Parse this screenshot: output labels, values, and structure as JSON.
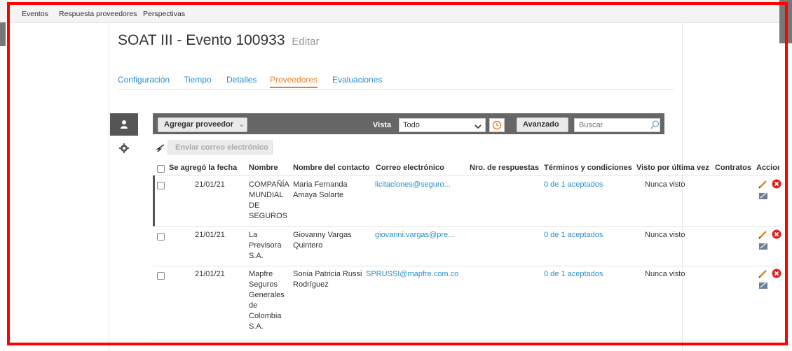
{
  "topnav": {
    "items": [
      "Eventos",
      "Respuesta proveedores",
      "Perspectivas"
    ]
  },
  "page": {
    "title": "SOAT III - Evento 100933",
    "edit_label": "Editar"
  },
  "tabs": [
    {
      "label": "Configuración",
      "active": false
    },
    {
      "label": "Tiempo",
      "active": false
    },
    {
      "label": "Detalles",
      "active": false
    },
    {
      "label": "Proveedores",
      "active": true
    },
    {
      "label": "Evaluaciones",
      "active": false
    }
  ],
  "toolbar": {
    "add_supplier_label": "Agregar proveedor",
    "view_label": "Vista",
    "view_value": "Todo",
    "advanced_label": "Avanzado",
    "search_placeholder": "Buscar",
    "send_email_label": "Enviar correo electrónico"
  },
  "table": {
    "columns": [
      "Se agregó la fecha",
      "Nombre",
      "Nombre del contacto",
      "Correo electrónico",
      "Nro. de respuestas",
      "Términos y condiciones",
      "Visto por última vez",
      "Contratos",
      "Acciones"
    ],
    "rows": [
      {
        "date": "21/01/21",
        "name_lines": [
          "COMPAÑÍA",
          "MUNDIAL",
          "DE",
          "SEGUROS"
        ],
        "contact_lines": [
          "Maria Fernanda",
          "Amaya Solarte"
        ],
        "email": "licitaciones@seguro...",
        "responses": "",
        "terms": "0 de 1 aceptados",
        "last_seen": "Nunca visto",
        "contracts": ""
      },
      {
        "date": "21/01/21",
        "name_lines": [
          "La",
          "Previsora",
          "S.A."
        ],
        "contact_lines": [
          "Giovanny Vargas",
          "Quintero"
        ],
        "email": "giovanni.vargas@pre...",
        "responses": "",
        "terms": "0 de 1 aceptados",
        "last_seen": "Nunca visto",
        "contracts": ""
      },
      {
        "date": "21/01/21",
        "name_lines": [
          "Mapfre",
          "Seguros",
          "Generales",
          "de",
          "Colombia",
          "S.A."
        ],
        "contact_lines": [
          "Sonia Patricia Russi",
          "Rodríguez"
        ],
        "email": "SPRUSSI@mapfre.com.co",
        "responses": "",
        "terms": "0 de 1 aceptados",
        "last_seen": "Nunca visto",
        "contracts": ""
      }
    ]
  },
  "colors": {
    "accent_orange": "#f07c1e",
    "link_blue": "#2a8fc7",
    "frame_red": "#ff0000",
    "delete_red": "#e02020"
  }
}
